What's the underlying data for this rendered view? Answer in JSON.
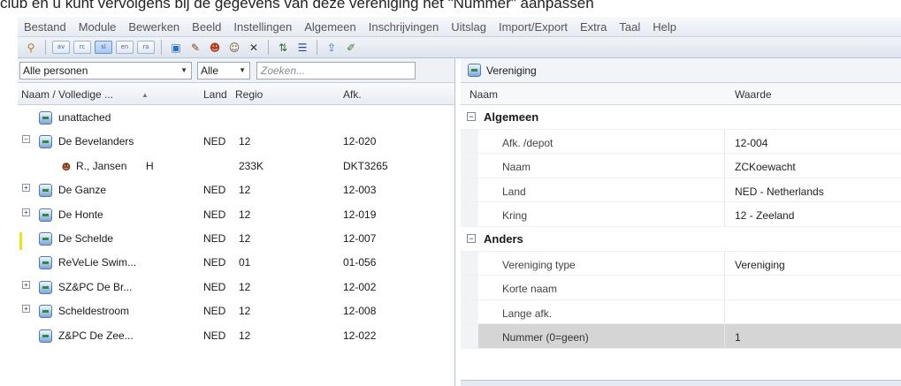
{
  "caption": "club en u kunt vervolgens bij de gegevens van deze vereniging het \"Nummer\" aanpassen",
  "menu": [
    "Bestand",
    "Module",
    "Bewerken",
    "Beeld",
    "Instellingen",
    "Algemeen",
    "Inschrijvingen",
    "Uitslag",
    "Import/Export",
    "Extra",
    "Taal",
    "Help"
  ],
  "toolbar": {
    "pill_labels": [
      "av",
      "rc",
      "sl",
      "en",
      "ra"
    ],
    "icons": [
      "home-icon",
      "add-club-icon",
      "edit-icon",
      "add-person-icon",
      "remove-person-icon",
      "delete-icon",
      "sort-icon",
      "sort-alt-icon",
      "export-icon",
      "edit-page-icon"
    ]
  },
  "filters": {
    "person_filter": "Alle personen",
    "region_filter": "Alle",
    "search_placeholder": "Zoeken..."
  },
  "list": {
    "headers": {
      "name": "Naam / Volledige ...",
      "land": "Land",
      "regio": "Regio",
      "afk": "Afk."
    },
    "rows": [
      {
        "type": "club",
        "expander": "",
        "name": "unattached",
        "gender": "",
        "land": "",
        "regio": "",
        "afk": ""
      },
      {
        "type": "club",
        "expander": "−",
        "name": "De Bevelanders",
        "gender": "",
        "land": "NED",
        "regio": "12",
        "afk": "12-020"
      },
      {
        "type": "person",
        "expander": "",
        "name": "R., Jansen",
        "gender": "H",
        "land": "",
        "regio": "233K",
        "afk": "DKT3265"
      },
      {
        "type": "club",
        "expander": "+",
        "name": "De Ganze",
        "gender": "",
        "land": "NED",
        "regio": "12",
        "afk": "12-003"
      },
      {
        "type": "club",
        "expander": "+",
        "name": "De Honte",
        "gender": "",
        "land": "NED",
        "regio": "12",
        "afk": "12-019"
      },
      {
        "type": "club",
        "expander": "",
        "name": "De Schelde",
        "gender": "",
        "land": "NED",
        "regio": "12",
        "afk": "12-007",
        "marked": true
      },
      {
        "type": "club",
        "expander": "",
        "name": "ReVeLie Swim...",
        "gender": "",
        "land": "NED",
        "regio": "01",
        "afk": "01-056"
      },
      {
        "type": "club",
        "expander": "+",
        "name": "SZ&PC De Br...",
        "gender": "",
        "land": "NED",
        "regio": "12",
        "afk": "12-002"
      },
      {
        "type": "club",
        "expander": "+",
        "name": "Scheldestroom",
        "gender": "",
        "land": "NED",
        "regio": "12",
        "afk": "12-008"
      },
      {
        "type": "club",
        "expander": "",
        "name": "Z&PC De Zee...",
        "gender": "",
        "land": "NED",
        "regio": "12",
        "afk": "12-022"
      }
    ]
  },
  "detail": {
    "title": "Vereniging",
    "headers": {
      "name": "Naam",
      "value": "Waarde"
    },
    "rows": [
      {
        "kind": "category",
        "toggle": "−",
        "label": "Algemeen"
      },
      {
        "kind": "prop",
        "label": "Afk. /depot",
        "value": "12-004"
      },
      {
        "kind": "prop",
        "label": "Naam",
        "value": "ZCKoewacht"
      },
      {
        "kind": "prop",
        "label": "Land",
        "value": "NED - Netherlands"
      },
      {
        "kind": "prop",
        "label": "Kring",
        "value": "12 - Zeeland"
      },
      {
        "kind": "category",
        "toggle": "−",
        "label": "Anders"
      },
      {
        "kind": "prop",
        "label": "Vereniging type",
        "value": "Vereniging"
      },
      {
        "kind": "prop",
        "label": "Korte naam",
        "value": ""
      },
      {
        "kind": "prop",
        "label": "Lange afk.",
        "value": ""
      },
      {
        "kind": "prop",
        "label": "Nummer (0=geen)",
        "value": "1",
        "selected": true
      }
    ]
  }
}
